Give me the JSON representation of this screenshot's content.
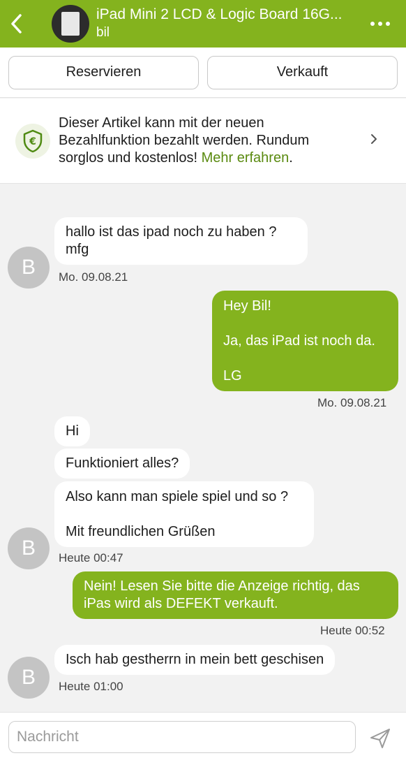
{
  "header": {
    "title": "iPad Mini 2 LCD & Logic Board 16G...",
    "subtitle": "bil",
    "back_icon": "chevron-left-icon",
    "more_icon": "more-horizontal-icon",
    "bg_color": "#84b31e"
  },
  "actions": {
    "reserve_label": "Reservieren",
    "sold_label": "Verkauft"
  },
  "promo": {
    "text": "Dieser Artikel kann mit der neuen Bezahlfunktion bezahlt werden. Rundum sorglos und kostenlos!",
    "link": "Mehr erfahren",
    "suffix": ".",
    "icon": "euro-shield-icon"
  },
  "messages": [
    {
      "side": "in",
      "lines": [
        "hallo ist das ipad noch zu haben ?",
        "mfg"
      ]
    },
    {
      "side": "out",
      "lines": [
        "Hey Bil!",
        "",
        "Ja, das iPad ist noch da.",
        "",
        "LG"
      ]
    },
    {
      "side": "in",
      "lines": [
        "Hi"
      ]
    },
    {
      "side": "in",
      "lines": [
        "Funktioniert alles?"
      ]
    },
    {
      "side": "in",
      "lines": [
        "Also kann man spiele spiel und so ?",
        "",
        "Mit freundlichen Grüßen"
      ]
    },
    {
      "side": "out",
      "lines": [
        "Nein! Lesen Sie bitte die Anzeige richtig, das",
        "iPas wird als DEFEKT verkauft."
      ]
    },
    {
      "side": "in",
      "lines": [
        "Isch hab gestherrn in mein bett geschisen"
      ]
    }
  ],
  "timestamps": [
    "Mo. 09.08.21",
    "Mo. 09.08.21",
    "Heute 00:47",
    "Heute 00:52",
    "Heute 01:00"
  ],
  "avatar_letter": "B",
  "composer": {
    "placeholder": "Nachricht",
    "send_icon": "send-icon"
  }
}
